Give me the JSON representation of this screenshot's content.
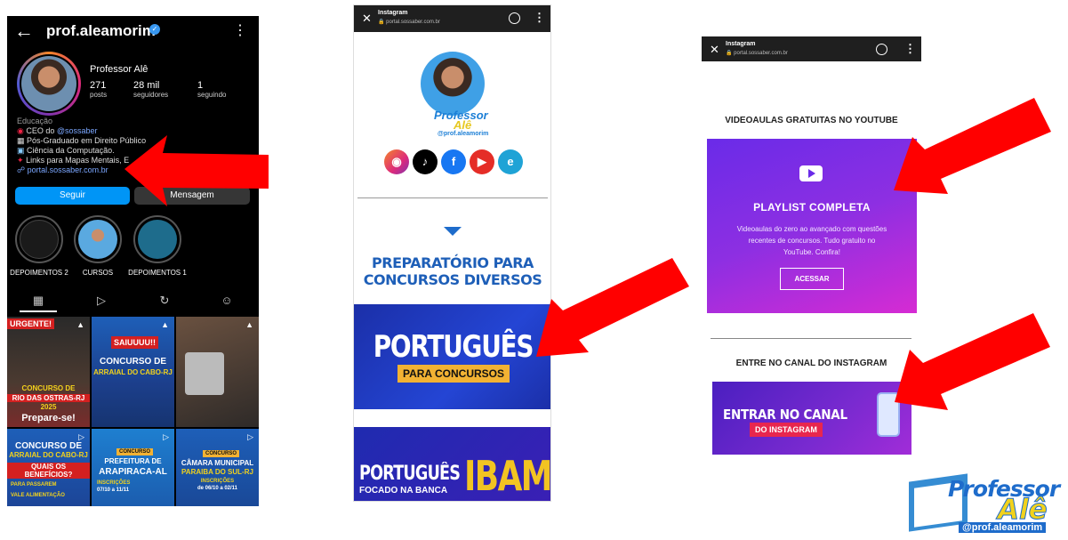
{
  "instagram": {
    "handle": "prof.aleamorim",
    "display_name": "Professor Alê",
    "stats": [
      {
        "value": "271",
        "label": "posts"
      },
      {
        "value": "28 mil",
        "label": "seguidores"
      },
      {
        "value": "1",
        "label": "seguindo"
      }
    ],
    "bio": {
      "category": "Educação",
      "line1_prefix": "CEO do ",
      "line1_mention": "@sossaber",
      "line2": "Pós-Graduado em Direito Público",
      "line3": "Ciência da Computação.",
      "line4": "Links para Mapas Mentais, E",
      "link": "portal.sossaber.com.br"
    },
    "buttons": {
      "follow": "Seguir",
      "message": "Mensagem"
    },
    "highlights": [
      "DEPOIMENTOS 2",
      "CURSOS",
      "DEPOIMENTOS 1"
    ],
    "posts": [
      {
        "badge": "URGENTE!",
        "lines": [
          "CONCURSO DE",
          "RIO DAS OSTRAS-RJ",
          "2025",
          "Prepare-se!"
        ]
      },
      {
        "badge": "SAIUUUU!!",
        "lines": [
          "CONCURSO DE",
          "ARRAIAL DO CABO-RJ"
        ]
      },
      {
        "badge": "",
        "lines": []
      },
      {
        "badge": "",
        "lines": [
          "CONCURSO DE",
          "ARRAIAL DO CABO-RJ",
          "QUAIS OS BENEFÍCIOS?",
          "PARA PASSAREM",
          "VALE ALIMENTAÇÃO"
        ]
      },
      {
        "badge": "CONCURSO",
        "lines": [
          "PREFEITURA DE",
          "ARAPIRACA-AL",
          "INSCRIÇÕES",
          "07/10 a 11/11"
        ]
      },
      {
        "badge": "CONCURSO",
        "lines": [
          "CÂMARA MUNICIPAL",
          "PARAIBA DO SUL-RJ",
          "INSCRIÇÕES",
          "de 06/10 a 02/11"
        ]
      }
    ]
  },
  "browser": {
    "tab_title": "Instagram",
    "url": "portal.sossaber.com.br"
  },
  "portal_left": {
    "logo_word1": "Professor",
    "logo_word2": "Alê",
    "logo_handle": "@prof.aleamorim",
    "section_title_1": "PREPARATÓRIO PARA",
    "section_title_2": "CONCURSOS DIVERSOS",
    "banner1_title": "PORTUGUÊS",
    "banner1_sub": "PARA CONCURSOS",
    "banner2_title": "PORTUGUÊS",
    "banner2_sub": "FOCADO NA BANCA",
    "banner2_brand": "IBAM"
  },
  "portal_right": {
    "youtube_heading": "VIDEOAULAS GRATUITAS NO YOUTUBE",
    "playlist_title": "PLAYLIST COMPLETA",
    "playlist_desc": "Videoaulas do zero ao avançado com questões recentes de concursos. Tudo gratuito no YouTube. Confira!",
    "cta": "ACESSAR",
    "instagram_heading": "ENTRE NO CANAL DO INSTAGRAM",
    "channel_title": "ENTRAR NO CANAL",
    "channel_sub": "DO INSTAGRAM"
  },
  "brand_logo": {
    "word1": "Professor",
    "word2": "Alê",
    "handle": "@prof.aleamorim"
  },
  "colors": {
    "arrow": "#ff0000",
    "instagram_blue": "#0095f6",
    "portal_blue": "#1e5fb8",
    "youtube_gradient_start": "#6a2be8",
    "youtube_gradient_end": "#d62bd3"
  }
}
